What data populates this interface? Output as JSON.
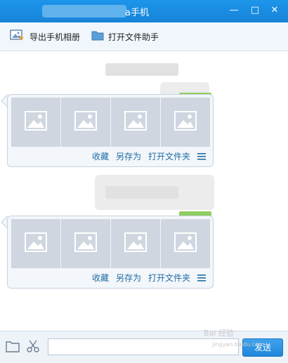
{
  "window": {
    "title": "a手机",
    "minimize_glyph": "—",
    "maximize_glyph": "□",
    "close_glyph": "✕"
  },
  "toolbar": {
    "export_album_label": "导出手机相册",
    "open_file_assistant_label": "打开文件助手"
  },
  "messages": [
    {
      "image_count": 4,
      "actions": {
        "collect": "收藏",
        "save_as": "另存为",
        "open_folder": "打开文件夹"
      }
    },
    {
      "image_count": 4,
      "actions": {
        "collect": "收藏",
        "save_as": "另存为",
        "open_folder": "打开文件夹"
      }
    }
  ],
  "inputbar": {
    "message_value": "",
    "send_label": "发送"
  },
  "watermark": {
    "line1": "Bai 经验",
    "line2": "jingyan.baidu.com"
  },
  "colors": {
    "titlebar": "#1784d8",
    "link": "#1f6ca6",
    "thumbnail": "#cfd6df"
  }
}
